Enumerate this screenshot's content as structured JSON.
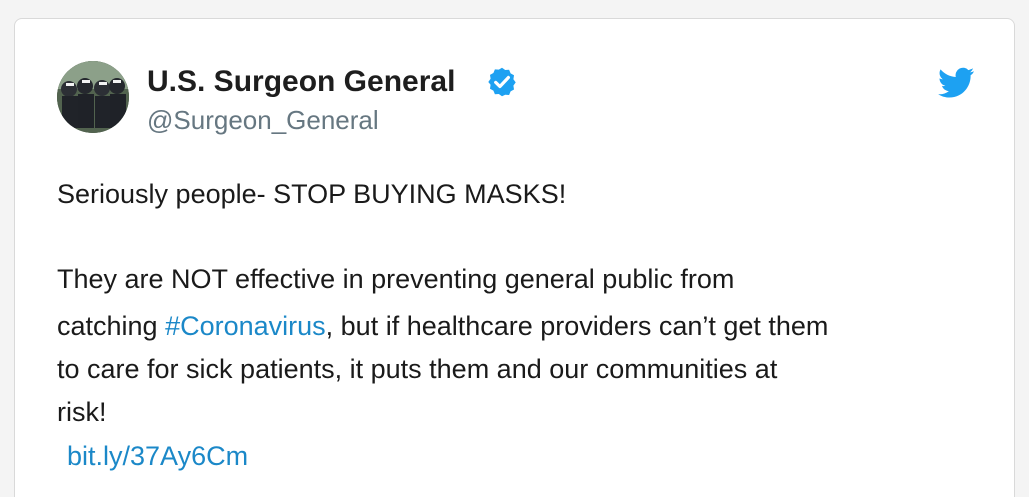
{
  "tweet": {
    "author": {
      "name": "U.S. Surgeon General",
      "handle": "@Surgeon_General",
      "verified_icon": "verified-badge-icon"
    },
    "platform_icon": "twitter-bird-icon",
    "text": {
      "line1": "Seriously people- STOP BUYING MASKS!",
      "line2": "They are NOT effective in preventing general public from",
      "line3_prefix": "catching ",
      "hashtag": "#Coronavirus",
      "line3_suffix": ", but if healthcare providers can’t get them",
      "line4": "to care for sick patients, it puts them and our communities at",
      "line5": "risk!"
    },
    "link": "bit.ly/37Ay6Cm"
  },
  "colors": {
    "link": "#1b88c8",
    "verified": "#1da1f2",
    "twitter": "#1da1f2"
  }
}
